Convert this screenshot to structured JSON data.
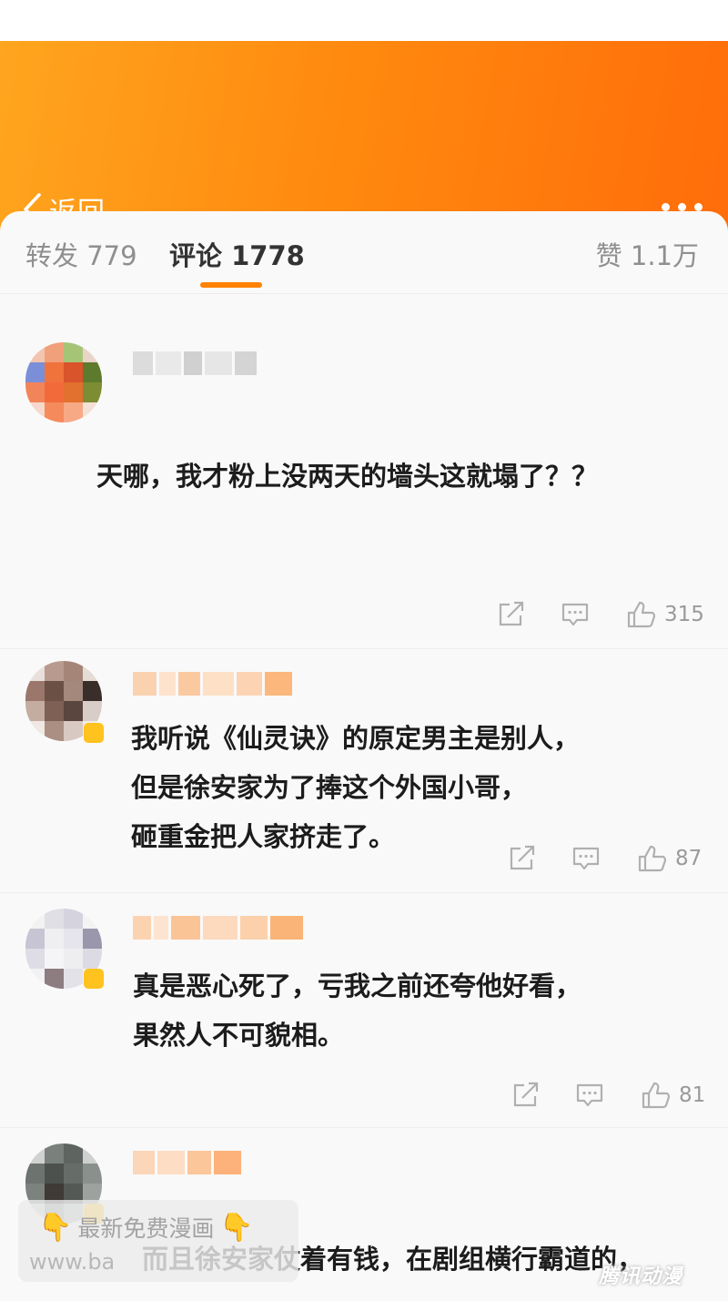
{
  "nav": {
    "back_label": "返回"
  },
  "tabs": [
    {
      "label": "转发",
      "count": "779",
      "active": false
    },
    {
      "label": "评论",
      "count": "1778",
      "active": true
    },
    {
      "label": "赞",
      "count": "1.1万",
      "active": false
    }
  ],
  "comments": [
    {
      "lines": [
        "天哪，我才粉上没两天的墙头这就塌了？？"
      ],
      "likes": "315"
    },
    {
      "lines": [
        "我听说《仙灵诀》的原定男主是别人，",
        "但是徐安家为了捧这个外国小哥，",
        "砸重金把人家挤走了。"
      ],
      "likes": "87"
    },
    {
      "lines": [
        "真是恶心死了，亏我之前还夸他好看，",
        "果然人不可貌相。"
      ],
      "likes": "81"
    },
    {
      "lines": [
        "而且徐安家仗着有钱，在剧组横行霸道的，"
      ],
      "likes": ""
    }
  ],
  "watermark": {
    "line1": "最新免费漫画",
    "line2": "www.ba",
    "hand": "👇"
  },
  "brand_logo": "腾讯动漫",
  "colors": {
    "header_start": "#ffa51e",
    "header_end": "#ff6d0a",
    "accent": "#ff8200",
    "badge": "#ffc21f"
  },
  "icons": [
    "chevron-left-icon",
    "more-dots-icon",
    "share-icon",
    "comment-icon",
    "like-icon",
    "hand-point-down-icon"
  ]
}
